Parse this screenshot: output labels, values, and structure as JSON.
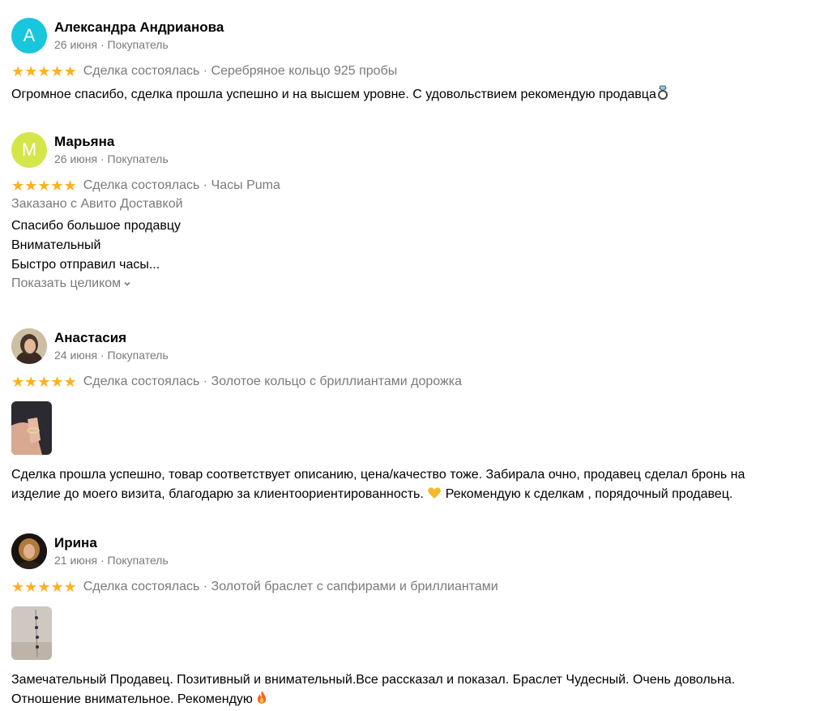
{
  "reviews": [
    {
      "avatar_letter": "А",
      "avatar_color": "#18c6de",
      "name": "Александра Андрианова",
      "meta": "26 июня · Покупатель",
      "stars": "★★★★★",
      "deal": "Сделка состоялась · Серебряное кольцо 925 пробы",
      "text": "Огромное спасибо, сделка прошла успешно и на высшем уровне. С удовольствием рекомендую продавца"
    },
    {
      "avatar_letter": "М",
      "avatar_color": "#d4e64a",
      "name": "Марьяна",
      "meta": "26 июня · Покупатель",
      "stars": "★★★★★",
      "deal": "Сделка состоялась · Часы Puma",
      "delivery": "Заказано с Авито Доставкой",
      "lines": [
        "Спасибо большое продавцу",
        "Внимательный",
        "Быстро отправил часы..."
      ],
      "show_more": "Показать целиком"
    },
    {
      "name": "Анастасия",
      "meta": "24 июня · Покупатель",
      "stars": "★★★★★",
      "deal": "Сделка состоялась · Золотое кольцо с бриллиантами дорожка",
      "text_lines": [
        "Сделка прошла успешно, товар соответствует описанию, цена/качество тоже. Забирала очно, продавец сделал бронь на",
        "изделие до моего визита, благодарю за клиентоориентированность.",
        " Рекомендую к сделкам , порядочный продавец."
      ]
    },
    {
      "name": "Ирина",
      "meta": "21 июня · Покупатель",
      "stars": "★★★★★",
      "deal": "Сделка состоялась · Золотой браслет с сапфирами и бриллиантами",
      "text_lines": [
        "Замечательный Продавец. Позитивный и внимательный.Все рассказал и показал. Браслет Чудесный. Очень довольна.",
        "Отношение внимательное. Рекомендую "
      ]
    }
  ],
  "colors": {
    "star": "#ffb021",
    "muted": "#7a7a7a"
  }
}
